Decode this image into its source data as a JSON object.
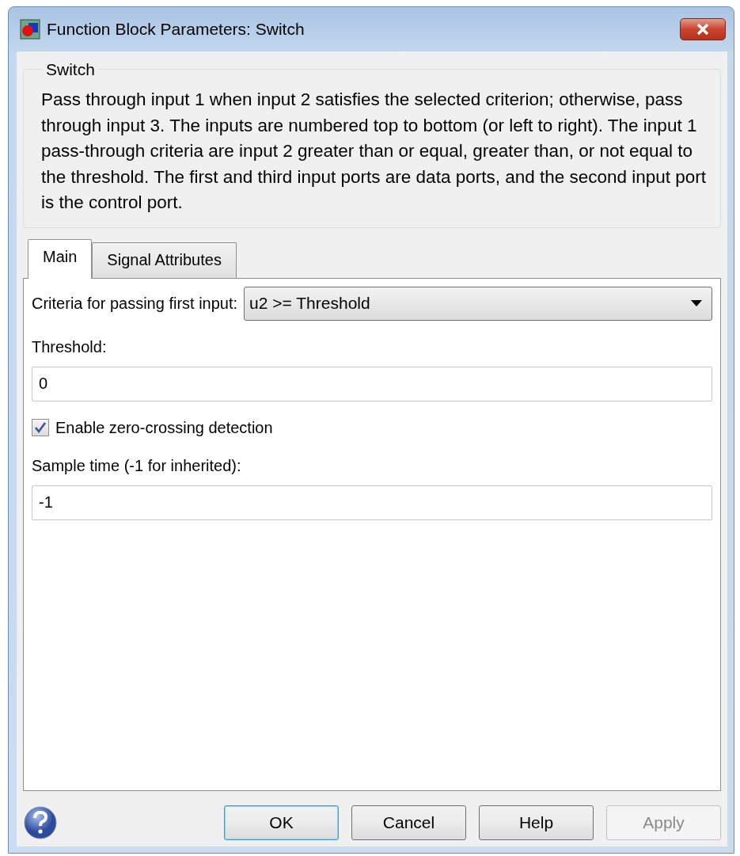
{
  "window": {
    "title": "Function Block Parameters: Switch"
  },
  "group": {
    "title": "Switch",
    "description": "Pass through input 1 when input 2 satisfies the selected criterion; otherwise, pass through input 3.  The inputs are numbered top to bottom (or left to right). The input 1 pass-through criteria are input 2 greater than or equal, greater than, or not equal to the threshold.  The first and third input ports are data ports, and the second input port is the control port."
  },
  "tabs": [
    {
      "label": "Main",
      "selected": true
    },
    {
      "label": "Signal Attributes",
      "selected": false
    }
  ],
  "fields": [
    {
      "kind": "dropdown",
      "label": "Criteria for passing first input:",
      "value": "u2 >= Threshold"
    },
    {
      "kind": "text",
      "label": "Threshold:",
      "value": "0"
    },
    {
      "kind": "checkbox",
      "label": "Enable zero-crossing detection",
      "checked": true
    },
    {
      "kind": "text",
      "label": "Sample time (-1 for inherited):",
      "value": "-1"
    }
  ],
  "buttons": [
    {
      "label": "OK",
      "focused": true,
      "disabled": false
    },
    {
      "label": "Cancel",
      "focused": false,
      "disabled": false
    },
    {
      "label": "Help",
      "focused": false,
      "disabled": false
    },
    {
      "label": "Apply",
      "focused": false,
      "disabled": true
    }
  ]
}
